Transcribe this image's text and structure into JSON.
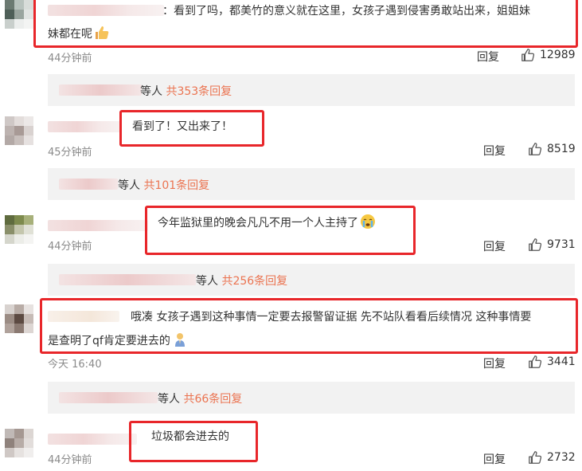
{
  "comments": [
    {
      "text_prefix": "：看到了吗，都美竹的意义就在这里，女孩子遇到侵害勇敢站出来，姐姐妹",
      "text_suffix": "妹都在呢",
      "emoji": "thumbs-up-emoji",
      "time": "44分钟前",
      "reply": "回复",
      "likes": "12989",
      "thread": {
        "who": "等人",
        "count": "共353条回复"
      }
    },
    {
      "text": "看到了！又出来了！",
      "time": "45分钟前",
      "reply": "回复",
      "likes": "8519",
      "thread": {
        "who": "等人",
        "count": "共101条回复"
      }
    },
    {
      "text": "今年监狱里的晚会凡凡不用一个人主持了",
      "emoji": "crying-face-emoji",
      "time": "44分钟前",
      "reply": "回复",
      "likes": "9731",
      "thread": {
        "who": "等人",
        "count": "共256条回复"
      }
    },
    {
      "text_line1": "哦凑 女孩子遇到这种事情一定要去报警留证据 先不站队看看后续情况  这种事情要",
      "text_line2": "是查明了qf肯定要进去的",
      "emoji": "praying-figure-emoji",
      "time": "今天 16:40",
      "reply": "回复",
      "likes": "3441",
      "thread": {
        "who": "等人",
        "count": "共66条回复"
      }
    },
    {
      "text": "垃圾都会进去的",
      "time": "44分钟前",
      "reply": "回复",
      "likes": "2732"
    }
  ],
  "colors": {
    "highlight": "#e8262a",
    "reply_count": "#eb7350",
    "reply_bar_bg": "#f2f2f2",
    "time": "#8a8a8a"
  }
}
